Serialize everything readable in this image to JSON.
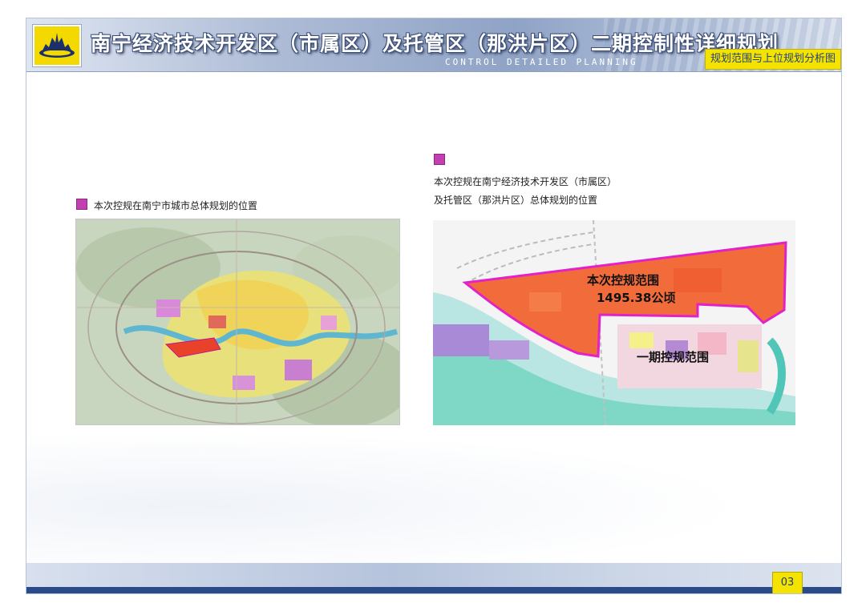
{
  "header": {
    "title": "南宁经济技术开发区（市属区）及托管区（那洪片区）二期控制性详细规划",
    "subtitle": "CONTROL DETAILED PLANNING",
    "section_tag": "规划范围与上位规划分析图"
  },
  "left_panel": {
    "caption": "本次控规在南宁市城市总体规划的位置"
  },
  "right_panel": {
    "caption_line1": "本次控规在南宁经济技术开发区（市属区）",
    "caption_line2": "及托管区（那洪片区）总体规划的位置",
    "label_scope": "本次控规范围",
    "label_area": "1495.38公顷",
    "label_phase1": "一期控规范围"
  },
  "footer": {
    "page_number": "03"
  },
  "colors": {
    "accent_yellow": "#f4e200",
    "header_blue": "#8fa3c6",
    "bullet_magenta": "#c33fb2",
    "scope_orange": "#f26b3a",
    "boundary_magenta": "#e022c8"
  }
}
